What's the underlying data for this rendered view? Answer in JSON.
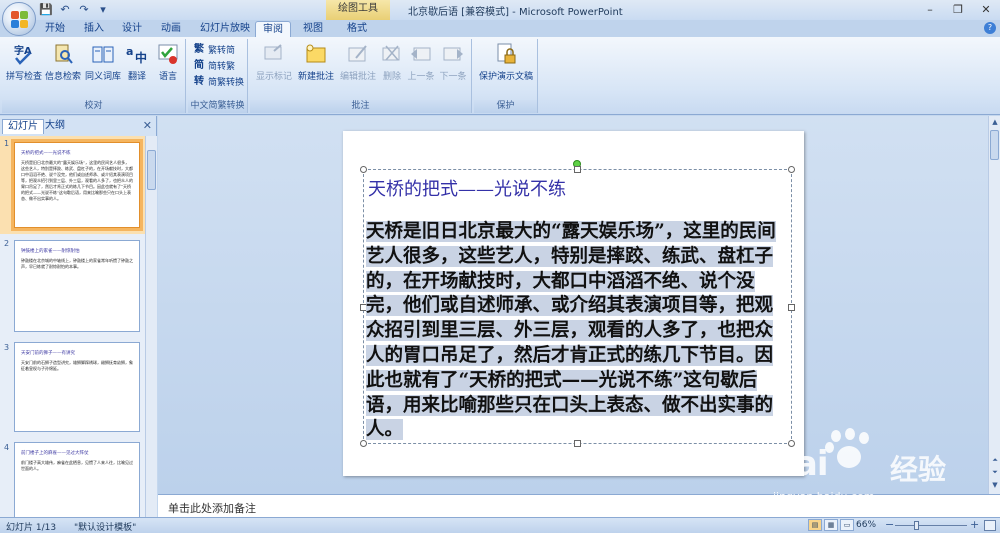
{
  "window": {
    "title": "北京歇后语 [兼容模式] - Microsoft PowerPoint",
    "context_group": "绘图工具",
    "controls": {
      "minimize": "–",
      "restore": "❐",
      "close": "✕"
    }
  },
  "qat": {
    "save": "💾",
    "undo": "↶",
    "redo": "↷",
    "more": "▾"
  },
  "tabs": [
    {
      "label": "开始"
    },
    {
      "label": "插入"
    },
    {
      "label": "设计"
    },
    {
      "label": "动画"
    },
    {
      "label": "幻灯片放映"
    },
    {
      "label": "审阅"
    },
    {
      "label": "视图"
    },
    {
      "label": "格式"
    }
  ],
  "ribbon": {
    "groups": {
      "proofing": "校对",
      "chinese_conversion": "中文简繁转换",
      "comments": "批注",
      "protect": "保护"
    },
    "proofing_buttons": [
      "拼写检查",
      "信息检索",
      "同义词库",
      "翻译",
      "语言"
    ],
    "conversion_buttons": [
      "繁转简",
      "简转繁",
      "简繁转换"
    ],
    "comment_buttons": [
      "显示标记",
      "新建批注",
      "编辑批注",
      "删除",
      "上一条",
      "下一条"
    ],
    "protect_buttons": [
      "保护演示文稿"
    ]
  },
  "left_pane": {
    "tabs": [
      "幻灯片",
      "大纲"
    ],
    "close": "✕",
    "slides": [
      {
        "num": "1",
        "title": "天桥的把式——光说不练",
        "body": "天桥是旧日北京最大的“露天娱乐场”，这里的民间艺人很多，这些艺人，特别是摔跤、练武、盘杠子的，在开场献技时，大都口中滔滔不绝、说个没完，他们或自述师承、或介绍其表演项目等，把观众招引到里三层、外三层，观看的人多了，也把众人的胃口吊足了，然后才肯正式的练几下节目。因此也就有了“天桥的把式——光说不练”这句歇后语，用来比喻那些只在口头上表态、做不出实事的人。"
      },
      {
        "num": "2",
        "title": "钟鼓楼上的家雀——耐惊耐怕",
        "body": "钟鼓楼在北京城的中轴线上，钟鼓楼上的家雀常年听惯了钟鼓之声，早已练就了耐惊耐怕的本事。"
      },
      {
        "num": "3",
        "title": "天安门前的狮子——有讲究",
        "body": "天安门前的石狮子造型讲究，雄狮脚踩绣球，雌狮抚育幼狮，象征着皇权与子孙绵延。"
      },
      {
        "num": "4",
        "title": "前门楼子上的麻雀——见过大阵仗",
        "body": "前门楼子高大雄伟，麻雀在此栖息，见惯了人来人往，比喻见过世面的人。"
      }
    ]
  },
  "slide": {
    "title": "天桥的把式——光说不练",
    "body": "天桥是旧日北京最大的“露天娱乐场”，这里的民间艺人很多，这些艺人，特别是摔跤、练武、盘杠子的，在开场献技时，大都口中滔滔不绝、说个没完，他们或自述师承、或介绍其表演项目等，把观众招引到里三层、外三层，观看的人多了，也把众人的胃口吊足了，然后才肯正式的练几下节目。因此也就有了“天桥的把式——光说不练”这句歇后语，用来比喻那些只在口头上表态、做不出实事的人。"
  },
  "notes": {
    "placeholder": "单击此处添加备注"
  },
  "status": {
    "slide_index": "幻灯片 1/13",
    "theme": "\"默认设计模板\"",
    "zoom": "66%",
    "zoom_minus": "−",
    "zoom_plus": "+"
  },
  "watermark": {
    "brand": "Bai",
    "brand2": "经验",
    "url": "jingyan.baidu.com"
  },
  "colors": {
    "accent": "#15428b",
    "title_purple": "#3431a8",
    "selection": "#f5b55f"
  }
}
